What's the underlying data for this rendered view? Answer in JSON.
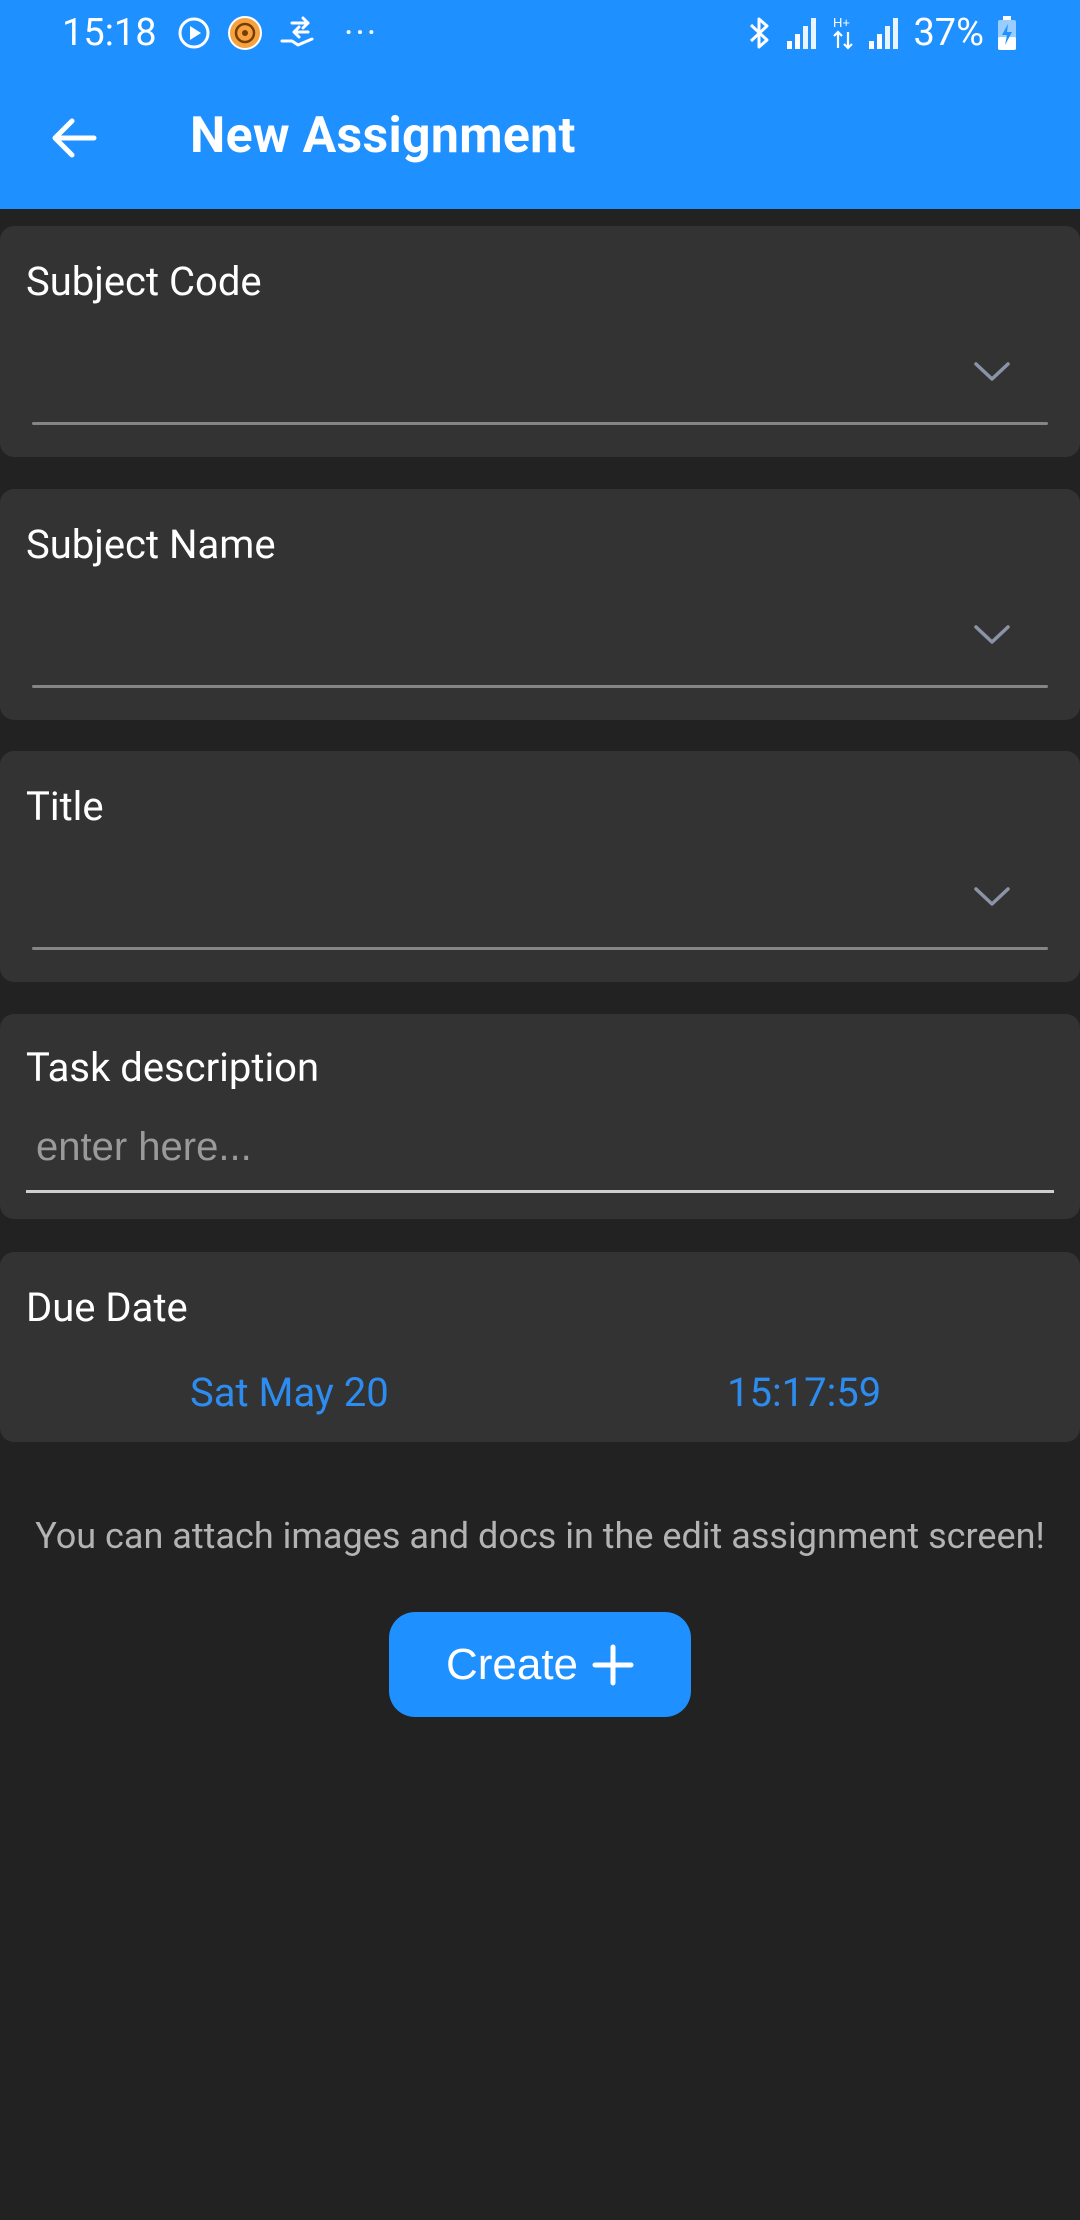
{
  "status_bar": {
    "time": "15:18",
    "more": "···",
    "battery": "37%"
  },
  "app_bar": {
    "title": "New Assignment"
  },
  "form": {
    "subject_code_label": "Subject Code",
    "subject_name_label": "Subject Name",
    "title_label": "Title",
    "task_description_label": "Task description",
    "task_description_placeholder": "enter here...",
    "due_date_label": "Due Date",
    "due_date_value": "Sat May 20",
    "due_time_value": "15:17:59"
  },
  "hint": "You can attach images and docs in the edit assignment screen!",
  "create_button": {
    "label": "Create"
  },
  "colors": {
    "accent": "#1e90ff",
    "background": "#222222",
    "card": "#333333",
    "link_text": "#2d8cf0"
  }
}
